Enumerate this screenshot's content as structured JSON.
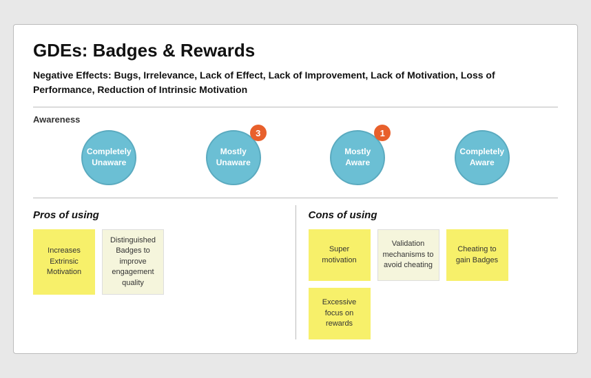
{
  "title": "GDEs: Badges & Rewards",
  "negative_effects_label": "Negative Effects",
  "negative_effects_text": ": Bugs, Irrelevance, Lack of Effect, Lack of Improvement, Lack of Motivation, Loss of Performance, Reduction of Intrinsic Motivation",
  "awareness_label": "Awareness",
  "awareness_items": [
    {
      "label": "Completely\nUnaware",
      "badge": null
    },
    {
      "label": "Mostly\nUnaware",
      "badge": "3"
    },
    {
      "label": "Mostly\nAware",
      "badge": "1"
    },
    {
      "label": "Completely\nAware",
      "badge": null
    }
  ],
  "pros_label": "Pros",
  "pros_suffix": " of using",
  "cons_label": "Cons",
  "cons_suffix": " of using",
  "pros_notes": [
    {
      "text": "Increases Extrinsic Motivation",
      "style": "yellow"
    },
    {
      "text": "Distinguished Badges to improve engagement quality",
      "style": "white"
    }
  ],
  "cons_notes": [
    {
      "text": "Super motivation",
      "style": "yellow"
    },
    {
      "text": "Validation mechanisms to avoid cheating",
      "style": "white"
    },
    {
      "text": "Cheating to gain Badges",
      "style": "yellow"
    },
    {
      "text": "Excessive focus on rewards",
      "style": "yellow"
    }
  ]
}
